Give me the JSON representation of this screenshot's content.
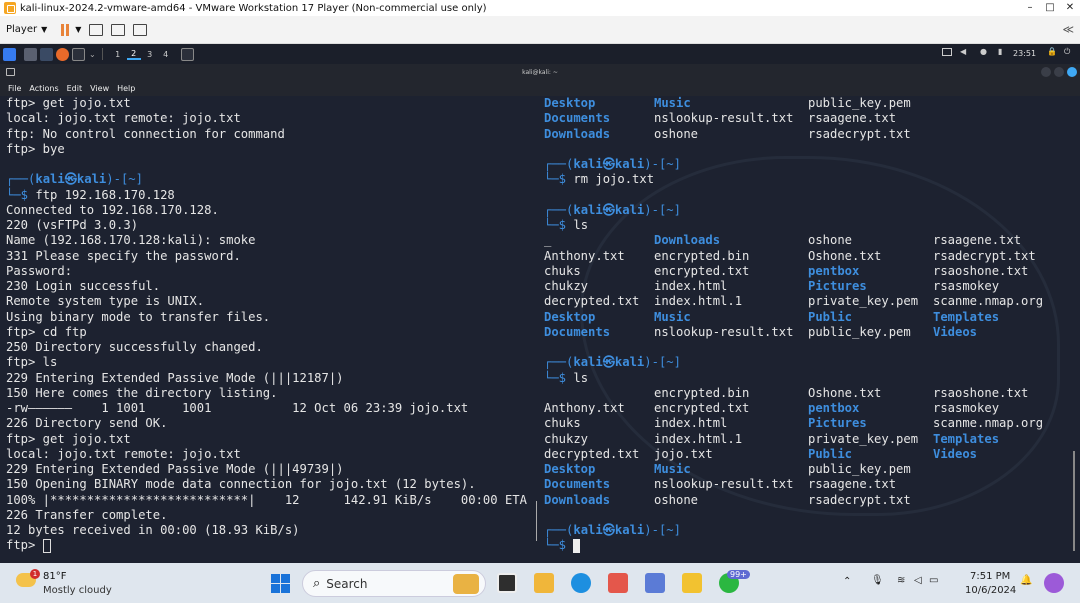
{
  "vm": {
    "title": "kali-linux-2024.2-vmware-amd64 - VMware Workstation 17 Player (Non-commercial use only)",
    "player_label": "Player",
    "min": "–",
    "max": "□",
    "close": "✕",
    "toggle": "≪"
  },
  "panel": {
    "workspaces": [
      "1",
      "2",
      "3",
      "4"
    ],
    "clock": "23:51"
  },
  "terminal": {
    "title": "kali@kali: ~",
    "menu": [
      "File",
      "Actions",
      "Edit",
      "View",
      "Help"
    ],
    "prompt_user": "kali",
    "prompt_at": "㉿",
    "prompt_host": "kali",
    "prompt_dir": "~",
    "left_lines_top": [
      "ftp> get jojo.txt",
      "local: jojo.txt remote: jojo.txt",
      "ftp: No control connection for command",
      "ftp> bye"
    ],
    "left_cmd1": "ftp 192.168.170.128",
    "left_lines_mid": [
      "Connected to 192.168.170.128.",
      "220 (vsFTPd 3.0.3)",
      "Name (192.168.170.128:kali): smoke",
      "331 Please specify the password.",
      "Password:",
      "230 Login successful.",
      "Remote system type is UNIX.",
      "Using binary mode to transfer files.",
      "ftp> cd ftp",
      "250 Directory successfully changed.",
      "ftp> ls",
      "229 Entering Extended Passive Mode (|||12187|)",
      "150 Here comes the directory listing.",
      "-rw——————    1 1001     1001           12 Oct 06 23:39 jojo.txt",
      "226 Directory send OK.",
      "ftp> get jojo.txt",
      "local: jojo.txt remote: jojo.txt",
      "229 Entering Extended Passive Mode (|||49739|)",
      "150 Opening BINARY mode data connection for jojo.txt (12 bytes).",
      "100% |***************************|    12      142.91 KiB/s    00:00 ETA",
      "226 Transfer complete.",
      "12 bytes received in 00:00 (18.93 KiB/s)",
      "ftp> "
    ],
    "right_top_rows": [
      [
        "Desktop",
        "Music",
        "public_key.pem"
      ],
      [
        "Documents",
        "nslookup-result.txt",
        "rsaagene.txt"
      ],
      [
        "Downloads",
        "oshone",
        "rsadecrypt.txt"
      ]
    ],
    "right_cmd_rm": "rm jojo.txt",
    "right_cmd_ls": "ls",
    "ls1_rows": [
      [
        "_",
        "Downloads",
        "oshone",
        "rsaagene.txt"
      ],
      [
        "Anthony.txt",
        "encrypted.bin",
        "Oshone.txt",
        "rsadecrypt.txt"
      ],
      [
        "chuks",
        "encrypted.txt",
        "pentbox",
        "rsaoshone.txt"
      ],
      [
        "chukzy",
        "index.html",
        "Pictures",
        "rsasmokey"
      ],
      [
        "decrypted.txt",
        "index.html.1",
        "private_key.pem",
        "scanme.nmap.org"
      ],
      [
        "Desktop",
        "Music",
        "Public",
        "Templates"
      ],
      [
        "Documents",
        "nslookup-result.txt",
        "public_key.pem",
        "Videos"
      ]
    ],
    "ls2_rows": [
      [
        "",
        "encrypted.bin",
        "Oshone.txt",
        "rsaoshone.txt"
      ],
      [
        "Anthony.txt",
        "encrypted.txt",
        "pentbox",
        "rsasmokey"
      ],
      [
        "chuks",
        "index.html",
        "Pictures",
        "scanme.nmap.org"
      ],
      [
        "chukzy",
        "index.html.1",
        "private_key.pem",
        "Templates"
      ],
      [
        "decrypted.txt",
        "jojo.txt",
        "Public",
        "Videos"
      ],
      [
        "Desktop",
        "Music",
        "public_key.pem",
        ""
      ],
      [
        "Documents",
        "nslookup-result.txt",
        "rsaagene.txt",
        ""
      ],
      [
        "Downloads",
        "oshone",
        "rsadecrypt.txt",
        ""
      ]
    ],
    "dir_names": [
      "Desktop",
      "Documents",
      "Downloads",
      "Music",
      "pentbox",
      "Pictures",
      "Public",
      "Templates",
      "Videos"
    ]
  },
  "taskbar": {
    "temp": "81°F",
    "weather": "Mostly cloudy",
    "weather_badge": "1",
    "search_placeholder": "Search",
    "notif_badge": "99+",
    "time": "7:51 PM",
    "date": "10/6/2024"
  }
}
